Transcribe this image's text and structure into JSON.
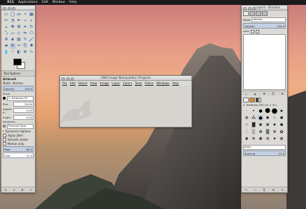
{
  "menubar": {
    "apple": "",
    "app": "X11",
    "items": [
      "Applications",
      "Edit",
      "Window",
      "Help"
    ]
  },
  "toolbox": {
    "title": "Toolbox - Tool Options",
    "options_tab": "Tool Options",
    "tool_name": "Airbrush",
    "mode_label": "Mode:",
    "mode_value": "Normal",
    "opacity_label": "Opacity",
    "opacity_value": "100.0",
    "brush_label": "Brush",
    "brush_value": "2. Hardness 05",
    "size_label": "Size",
    "size_value": "20.00",
    "aspect_label": "Aspect R...",
    "aspect_value": "0.00",
    "angle_label": "Angle",
    "angle_value": "0.00",
    "dynamics_label": "Dynamics",
    "dynamics_value": "Pressure Opac",
    "options": [
      "Dynamics Options",
      "Apply Jitter",
      "Smooth stroke",
      "Motion only"
    ],
    "rate_label": "Rate",
    "rate_value": "80.0",
    "flow_label": "Flow",
    "flow_value": "10.0"
  },
  "mainwin": {
    "title": "GNU Image Manipulation Program",
    "menu": [
      "File",
      "Edit",
      "Select",
      "View",
      "Image",
      "Layer",
      "Colors",
      "Tools",
      "Filters",
      "Windows",
      "Help"
    ]
  },
  "layers": {
    "title": "Layers - Brushes",
    "mode_label": "Mode",
    "mode_value": "Normal",
    "opacity_label": "Opacity",
    "opacity_value": "100.0",
    "lock_label": "Lock:",
    "brush_name": "2. Hardness 050 (51 × 51)",
    "tag_placeholder": "Basic",
    "spacing_label": "Spacing",
    "spacing_value": "10.0"
  }
}
